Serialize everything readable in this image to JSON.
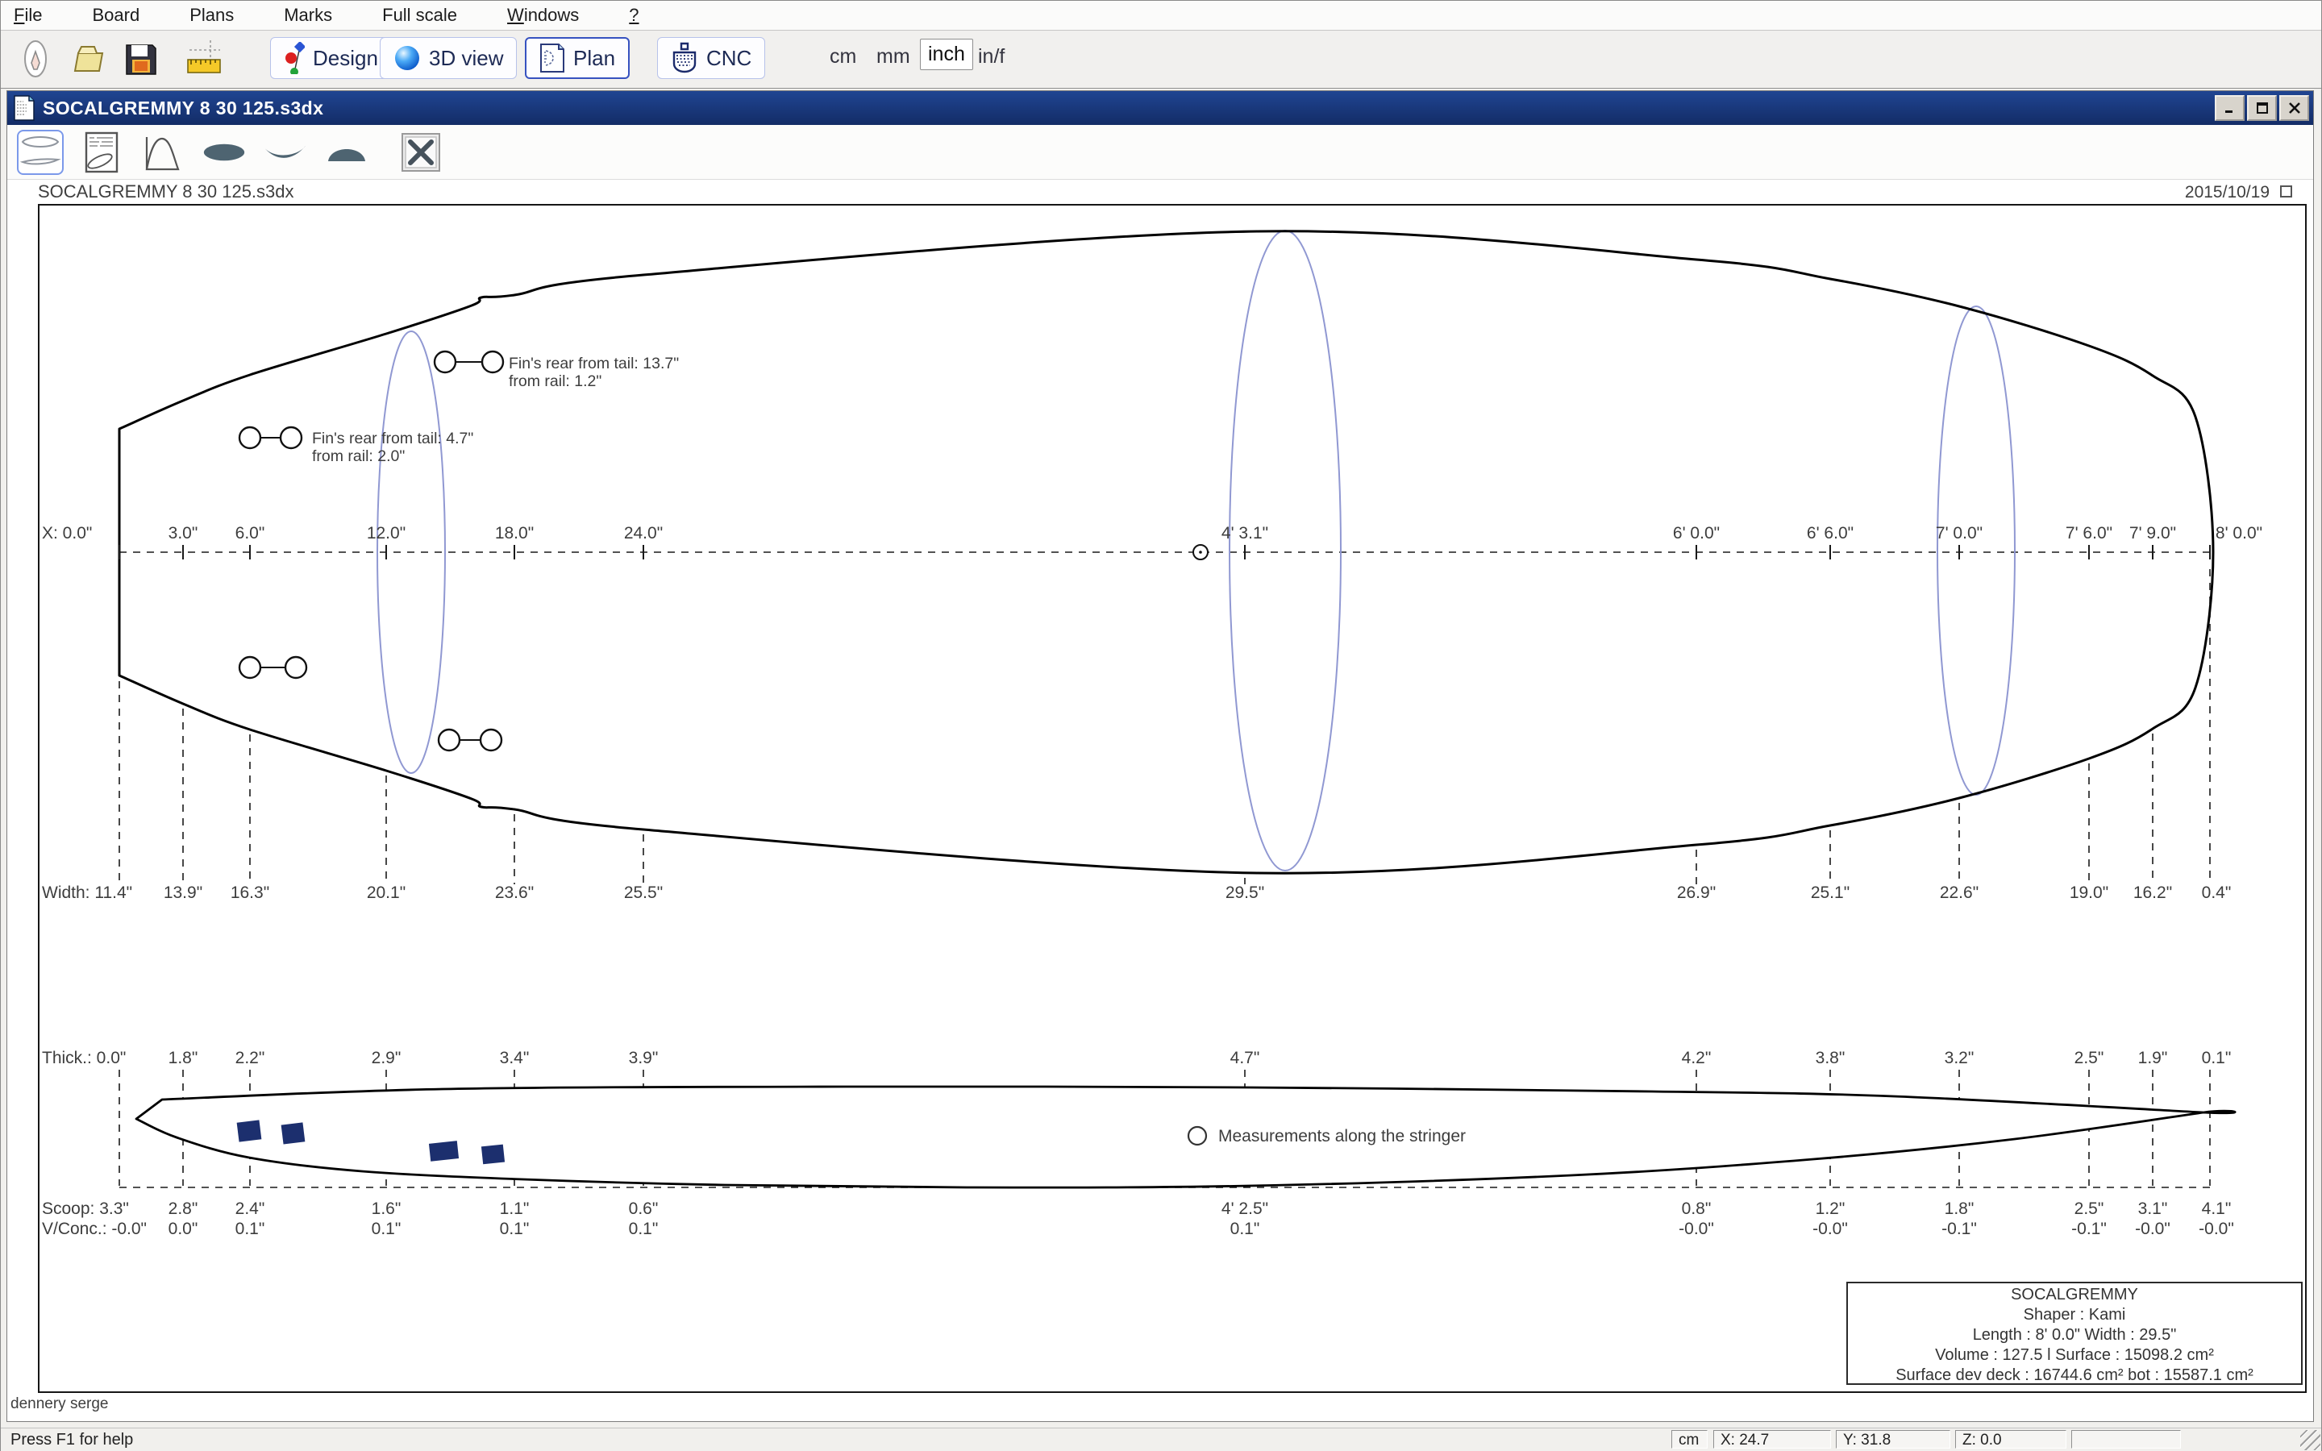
{
  "menubar": {
    "items": [
      {
        "accel": "F",
        "rest": "ile"
      },
      {
        "accel": "",
        "rest": "Board"
      },
      {
        "accel": "",
        "rest": "Plans"
      },
      {
        "accel": "",
        "rest": "Marks"
      },
      {
        "accel": "",
        "rest": "Full scale"
      },
      {
        "accel": "W",
        "rest": "indows"
      },
      {
        "accel": "?",
        "rest": ""
      }
    ]
  },
  "toolbar": {
    "design_label": "Design",
    "view3d_label": "3D view",
    "plan_label": "Plan",
    "cnc_label": "CNC",
    "units": [
      "cm",
      "mm",
      "inch",
      "in/f"
    ],
    "selected_unit": "inch"
  },
  "window": {
    "title": "SOCALGREMMY 8 30 125.s3dx"
  },
  "sheet": {
    "filename": "SOCALGREMMY 8 30 125.s3dx",
    "date": "2015/10/19",
    "author": "dennery serge"
  },
  "drawing": {
    "stations": [
      {
        "px": 99,
        "x": "X: 0.0\"",
        "width": "Width: 11.4\"",
        "thick": "Thick.: 0.0\"",
        "scoop": "Scoop: 3.3\"",
        "vconc": "V/Conc.: -0.0\""
      },
      {
        "px": 178,
        "x": "3.0\"",
        "width": "13.9\"",
        "thick": "1.8\"",
        "scoop": "2.8\"",
        "vconc": "0.0\""
      },
      {
        "px": 261,
        "x": "6.0\"",
        "width": "16.3\"",
        "thick": "2.2\"",
        "scoop": "2.4\"",
        "vconc": "0.1\""
      },
      {
        "px": 430,
        "x": "12.0\"",
        "width": "20.1\"",
        "thick": "2.9\"",
        "scoop": "1.6\"",
        "vconc": "0.1\""
      },
      {
        "px": 589,
        "x": "18.0\"",
        "width": "23.6\"",
        "thick": "3.4\"",
        "scoop": "1.1\"",
        "vconc": "0.1\""
      },
      {
        "px": 749,
        "x": "24.0\"",
        "width": "25.5\"",
        "thick": "3.9\"",
        "scoop": "0.6\"",
        "vconc": "0.1\""
      },
      {
        "px": 1495,
        "x": "4' 3.1\"",
        "width": "29.5\"",
        "thick": "4.7\"",
        "scoop": "4' 2.5\"",
        "vconc": "0.1\""
      },
      {
        "px": 2055,
        "x": "6' 0.0\"",
        "width": "26.9\"",
        "thick": "4.2\"",
        "scoop": "0.8\"",
        "vconc": "-0.0\""
      },
      {
        "px": 2221,
        "x": "6' 6.0\"",
        "width": "25.1\"",
        "thick": "3.8\"",
        "scoop": "1.2\"",
        "vconc": "-0.0\""
      },
      {
        "px": 2381,
        "x": "7' 0.0\"",
        "width": "22.6\"",
        "thick": "3.2\"",
        "scoop": "1.8\"",
        "vconc": "-0.1\""
      },
      {
        "px": 2542,
        "x": "7' 6.0\"",
        "width": "19.0\"",
        "thick": "2.5\"",
        "scoop": "2.5\"",
        "vconc": "-0.1\""
      },
      {
        "px": 2621,
        "x": "7' 9.0\"",
        "width": "16.2\"",
        "thick": "1.9\"",
        "scoop": "3.1\"",
        "vconc": "-0.0\""
      },
      {
        "px": 2692,
        "x": "8' 0.0\"",
        "width": "0.4\"",
        "thick": "0.1\"",
        "scoop": "4.1\"",
        "vconc": "-0.0\""
      }
    ],
    "fins": [
      {
        "line1": "Fin's rear from tail: 13.7\"",
        "line2": "from rail: 1.2\""
      },
      {
        "line1": "Fin's rear from tail: 4.7\"",
        "line2": "from rail: 2.0\""
      }
    ],
    "stringer_note": "Measurements along the stringer",
    "infobox": {
      "lines": [
        "SOCALGREMMY",
        "Shaper : Kami",
        "Length : 8' 0.0\" Width  : 29.5\"",
        "Volume : 127.5 l  Surface : 15098.2 cm²",
        "Surface dev deck : 16744.6 cm² bot : 15587.1 cm²"
      ]
    },
    "colors": {
      "outline": "#000000",
      "slice": "#9098d2",
      "fin_plug": "#1c2f6e",
      "titlebar": "#16336f",
      "accent_border": "#3752c0"
    }
  },
  "statusbar": {
    "help": "Press F1 for help",
    "fields": [
      "cm",
      "X: 24.7",
      "Y: 31.8",
      "Z: 0.0",
      ""
    ]
  }
}
